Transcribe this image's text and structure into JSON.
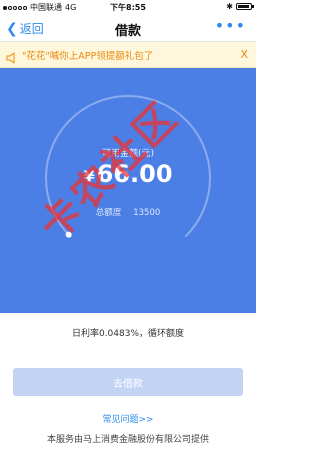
{
  "status_bar": {
    "carrier": "中国联通",
    "network": "4G",
    "time": "下午8:55"
  },
  "nav": {
    "back_label": "返回",
    "title": "借款",
    "more_label": "•••"
  },
  "notice": {
    "text": "\"花花\"喊你上APP领提额礼包了",
    "close_label": "X"
  },
  "hero": {
    "amount_label": "可用金额(元)",
    "currency": "¥",
    "amount": "66.00",
    "limit_label": "总额度",
    "limit_value": "13500",
    "progress": 0.005
  },
  "main": {
    "rate_text": "日利率0.0483%，循环额度",
    "borrow_button": "去借款",
    "faq_link": "常见问题>>",
    "footer_text": "本服务由马上消费金融股份有限公司提供"
  },
  "watermark": {
    "text": "卡农社区"
  },
  "colors": {
    "accent": "#2d8bf0",
    "hero_bg": "#4c7fe5",
    "notice_text": "#e88a12",
    "button_disabled": "#c3d3f4",
    "watermark": "#eb3232"
  }
}
